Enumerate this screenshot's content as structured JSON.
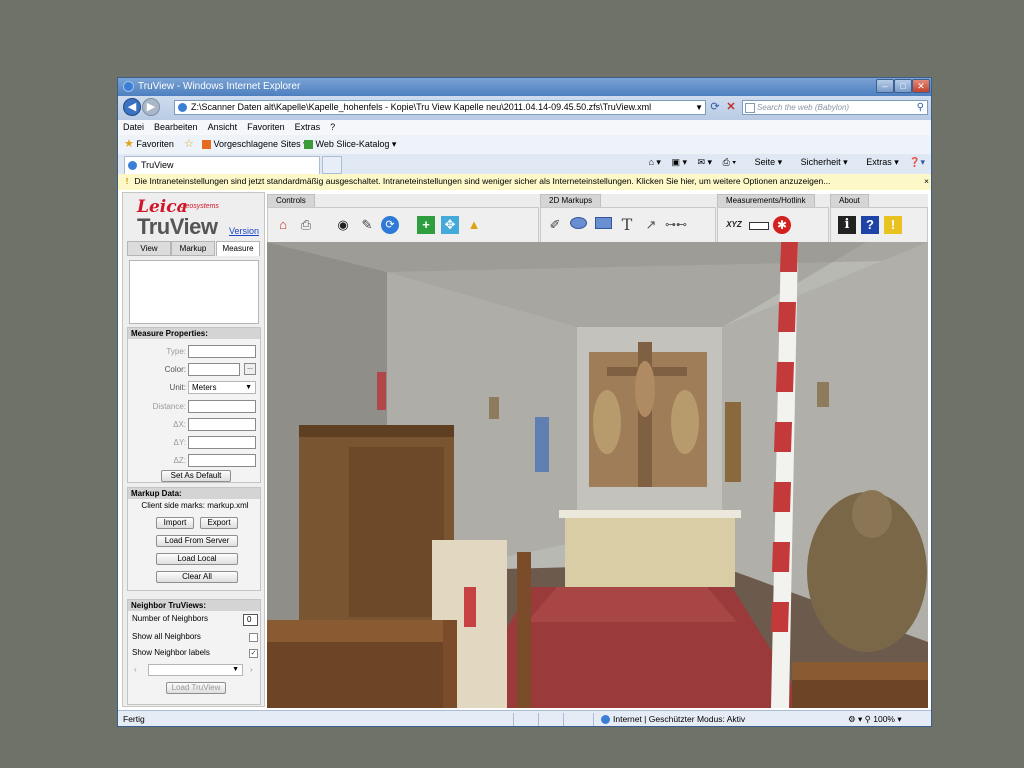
{
  "window": {
    "title": "TruView - Windows Internet Explorer",
    "address": "Z:\\Scanner Daten alt\\Kapelle\\Kapelle_hohenfels - Kopie\\Tru View Kapelle neu\\2011.04.14-09.45.50.zfs\\TruView.xml",
    "search_placeholder": "Search the web (Babylon)"
  },
  "menu": [
    "Datei",
    "Bearbeiten",
    "Ansicht",
    "Favoriten",
    "Extras",
    "?"
  ],
  "favbar": {
    "favorites": "Favoriten",
    "suggested": "Vorgeschlagene Sites",
    "webslice": "Web Slice-Katalog"
  },
  "tab": {
    "title": "TruView"
  },
  "cmdbar": {
    "page": "Seite",
    "security": "Sicherheit",
    "extras": "Extras"
  },
  "infobar": {
    "text": "Die Intraneteinstellungen sind jetzt standardmäßig ausgeschaltet. Intraneteinstellungen sind weniger sicher als Interneteinstellungen. Klicken Sie hier, um weitere Optionen anzuzeigen..."
  },
  "panel": {
    "logo_leica": "Leica",
    "logo_geo": "Geosystems",
    "logo_truview": "TruView",
    "version": "Version",
    "tabs": [
      "View",
      "Markup",
      "Measure"
    ],
    "measure": {
      "header": "Measure Properties:",
      "type": "Type:",
      "color": "Color:",
      "unit": "Unit:",
      "unit_value": "Meters",
      "distance": "Distance:",
      "dx": "ΔX:",
      "dy": "ΔY:",
      "dz": "ΔZ:",
      "default_button": "Set As Default"
    },
    "markup": {
      "header": "Markup Data:",
      "client": "Client side marks: markup.xml",
      "import": "Import",
      "export": "Export",
      "load_server": "Load From Server",
      "load_local": "Load Local",
      "clear_all": "Clear All"
    },
    "neighbors": {
      "header": "Neighbor TruViews:",
      "number_label": "Number of Neighbors",
      "number_value": "0",
      "show_all": "Show all Neighbors",
      "show_labels": "Show Neighbor labels",
      "load": "Load TruView"
    }
  },
  "toolbar": {
    "groups": [
      "Controls",
      "2D Markups",
      "Measurements/Hotlink",
      "About"
    ],
    "xyz": "XYZ"
  },
  "status": {
    "left": "Fertig",
    "zone": "Internet | Geschützter Modus: Aktiv",
    "zoom": "100%"
  }
}
